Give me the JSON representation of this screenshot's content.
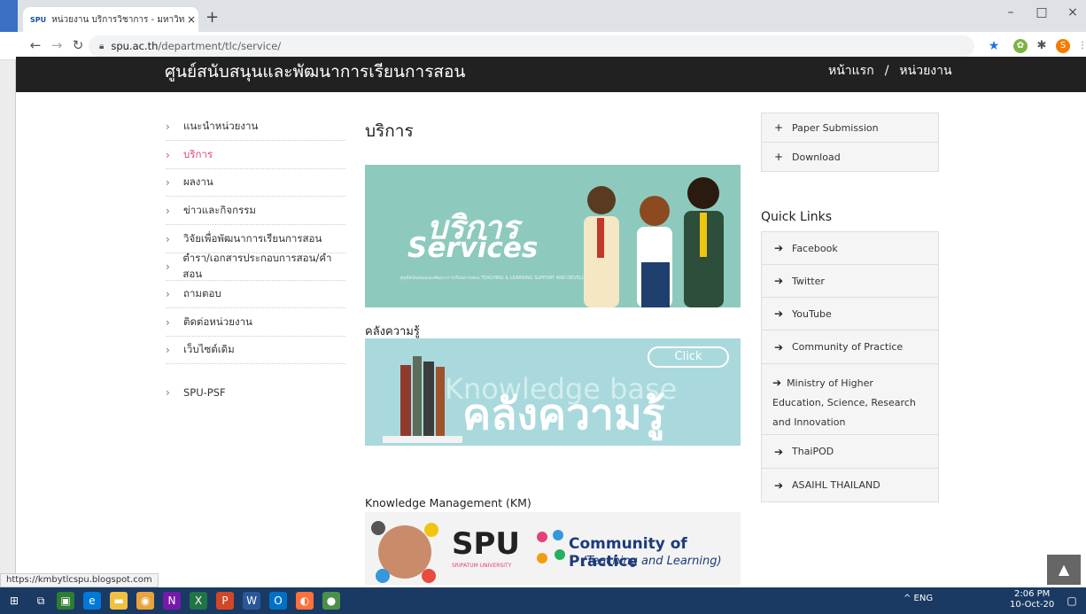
{
  "browser": {
    "tab_favicon": "SPU",
    "tab_title": "หน่วยงาน บริการวิชาการ - มหาวิทยาลั",
    "tab_close": "×",
    "new_tab": "+",
    "url_host": "spu.ac.th",
    "url_path": "/department/tlc/service/",
    "status_url": "https://kmbytlcspu.blogspot.com",
    "window_min": "–",
    "window_max": "□",
    "window_close": "×"
  },
  "site": {
    "title": "ศูนย์สนับสนุนและพัฒนาการเรียนการสอน",
    "nav": {
      "home": "หน้าแรก",
      "sep": "/",
      "dept": "หน่วยงาน"
    }
  },
  "left_menu": [
    {
      "label": "แนะนำหน่วยงาน",
      "active": false
    },
    {
      "label": "บริการ",
      "active": true
    },
    {
      "label": "ผลงาน",
      "active": false
    },
    {
      "label": "ข่าวและกิจกรรม",
      "active": false
    },
    {
      "label": "วิจัยเพื่อพัฒนาการเรียนการสอน",
      "active": false
    },
    {
      "label": "ตำรา/เอกสารประกอบการสอน/คำสอน",
      "active": false
    },
    {
      "label": "ถามตอบ",
      "active": false
    },
    {
      "label": "ติดต่อหน่วยงาน",
      "active": false
    },
    {
      "label": "เว็บไซต์เดิม",
      "active": false
    }
  ],
  "left_extra": "SPU-PSF",
  "main": {
    "title": "บริการ",
    "banner1": {
      "line1": "บริการ",
      "line2": "Services",
      "line3": "ศูนย์สนับสนุนและพัฒนาการเรียนการสอน TEACHING & LEARNING SUPPORT AND DEVELOPMENT"
    },
    "kb_title": "คลังความรู้",
    "banner2": {
      "bg_text": "Knowledge base",
      "main_text": "คลังความรู้",
      "click": "Click"
    },
    "km_title": "Knowledge Management (KM)",
    "banner3": {
      "spu": "SPU",
      "spu_sub": "SRIPATUM UNIVERSITY",
      "cop": "Community of Practice",
      "cop_sub": "(Teaching and Learning)"
    }
  },
  "right": {
    "top_links": [
      "Paper Submission",
      "Download"
    ],
    "quick_title": "Quick Links",
    "quick_links": [
      "Facebook",
      "Twitter",
      "YouTube",
      "Community of Practice"
    ],
    "ministry": "Ministry of Higher Education, Science, Research and Innovation",
    "quick_links2": [
      "ThaiPOD",
      "ASAIHL THAILAND"
    ]
  },
  "taskbar": {
    "tray": "^ ENG",
    "time": "2:06 PM",
    "date": "10-Oct-20"
  }
}
